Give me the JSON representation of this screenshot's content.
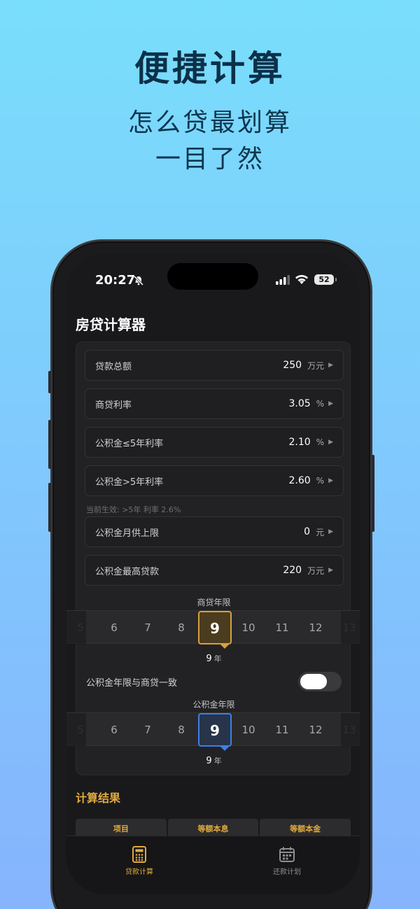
{
  "hero": {
    "title": "便捷计算",
    "subtitle_line1": "怎么贷最划算",
    "subtitle_line2": "一目了然"
  },
  "status_bar": {
    "time": "20:27",
    "battery": "52"
  },
  "app": {
    "title": "房贷计算器"
  },
  "inputs": [
    {
      "label": "贷款总额",
      "value": "250",
      "unit": "万元"
    },
    {
      "label": "商贷利率",
      "value": "3.05",
      "unit": "%"
    },
    {
      "label": "公积金≤5年利率",
      "value": "2.10",
      "unit": "%"
    },
    {
      "label": "公积金>5年利率",
      "value": "2.60",
      "unit": "%"
    },
    {
      "label": "公积金月供上限",
      "value": "0",
      "unit": "元"
    },
    {
      "label": "公积金最高贷款",
      "value": "220",
      "unit": "万元"
    }
  ],
  "hint": "当前生效: >5年 利率 2.6%",
  "commercial_picker": {
    "label": "商贷年限",
    "left_items": [
      "5",
      "6",
      "7",
      "8"
    ],
    "selected": "9",
    "right_items": [
      "10",
      "11",
      "12",
      "13"
    ],
    "readout_value": "9",
    "readout_unit": "年"
  },
  "sync_toggle": {
    "label": "公积金年限与商贷一致",
    "on": false
  },
  "fund_picker": {
    "label": "公积金年限",
    "left_items": [
      "5",
      "6",
      "7",
      "8"
    ],
    "selected": "9",
    "right_items": [
      "10",
      "11",
      "12",
      "13"
    ],
    "readout_value": "9",
    "readout_unit": "年"
  },
  "results": {
    "title": "计算结果",
    "headers": [
      "项目",
      "等额本息",
      "等额本金"
    ]
  },
  "tabbar": {
    "tabs": [
      {
        "label": "贷款计算",
        "icon": "calculator-icon",
        "active": true
      },
      {
        "label": "还款计划",
        "icon": "calendar-icon",
        "active": false
      }
    ]
  },
  "colors": {
    "accent": "#e0aa3e",
    "blue_accent": "#3f7ee6",
    "background_top": "#79defb",
    "background_bottom": "#86b4fd"
  }
}
